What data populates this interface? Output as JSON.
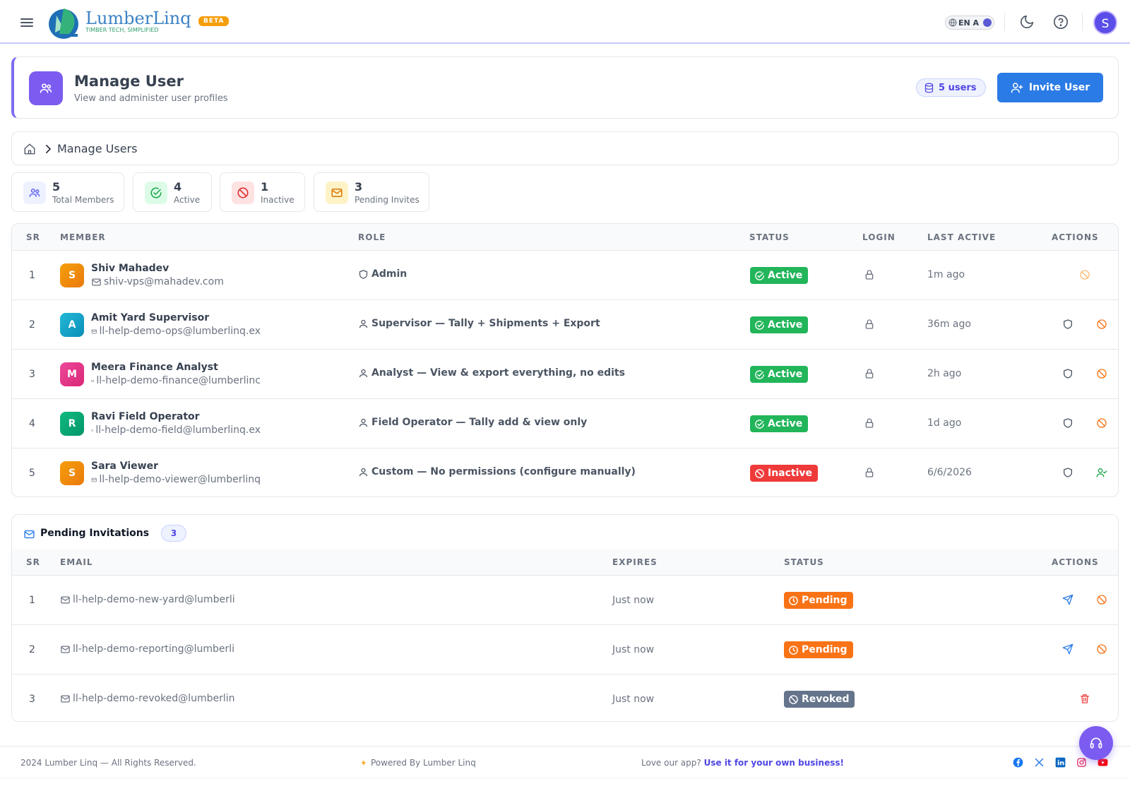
{
  "brand": {
    "name": "LumberLinq",
    "tagline": "TIMBER TECH, SIMPLIFIED",
    "beta": "BETA"
  },
  "topbar": {
    "lang": "EN A",
    "avatar_initial": "S"
  },
  "header": {
    "title": "Manage User",
    "subtitle": "View and administer user profiles",
    "user_count": "5 users",
    "invite_label": "Invite User"
  },
  "breadcrumb": {
    "current": "Manage Users"
  },
  "stats": [
    {
      "value": "5",
      "label": "Total Members"
    },
    {
      "value": "4",
      "label": "Active"
    },
    {
      "value": "1",
      "label": "Inactive"
    },
    {
      "value": "3",
      "label": "Pending Invites"
    }
  ],
  "members_table": {
    "headers": {
      "sr": "SR",
      "member": "MEMBER",
      "role": "ROLE",
      "status": "STATUS",
      "login": "LOGIN",
      "last_active": "LAST ACTIVE",
      "actions": "ACTIONS"
    },
    "rows": [
      {
        "sr": "1",
        "initial": "S",
        "name": "Shiv Mahadev",
        "email": "shiv-vps@mahadev.com",
        "role": "Admin",
        "status": "Active",
        "last_active": "1m ago"
      },
      {
        "sr": "2",
        "initial": "A",
        "name": "Amit Yard Supervisor",
        "email": "ll-help-demo-ops@lumberlinq.ex",
        "role": "Supervisor — Tally + Shipments + Export",
        "status": "Active",
        "last_active": "36m ago"
      },
      {
        "sr": "3",
        "initial": "M",
        "name": "Meera Finance Analyst",
        "email": "ll-help-demo-finance@lumberlinc",
        "role": "Analyst — View & export everything, no edits",
        "status": "Active",
        "last_active": "2h ago"
      },
      {
        "sr": "4",
        "initial": "R",
        "name": "Ravi Field Operator",
        "email": "ll-help-demo-field@lumberlinq.ex",
        "role": "Field Operator — Tally add & view only",
        "status": "Active",
        "last_active": "1d ago"
      },
      {
        "sr": "5",
        "initial": "S",
        "name": "Sara Viewer",
        "email": "ll-help-demo-viewer@lumberlinq",
        "role": "Custom — No permissions (configure manually)",
        "status": "Inactive",
        "last_active": "6/6/2026"
      }
    ]
  },
  "invitations": {
    "title": "Pending Invitations",
    "count": "3",
    "headers": {
      "sr": "SR",
      "email": "EMAIL",
      "expires": "EXPIRES",
      "status": "STATUS",
      "actions": "ACTIONS"
    },
    "rows": [
      {
        "sr": "1",
        "email": "ll-help-demo-new-yard@lumberli",
        "expires": "Just now",
        "status": "Pending"
      },
      {
        "sr": "2",
        "email": "ll-help-demo-reporting@lumberli",
        "expires": "Just now",
        "status": "Pending"
      },
      {
        "sr": "3",
        "email": "ll-help-demo-revoked@lumberlin",
        "expires": "Just now",
        "status": "Revoked"
      }
    ]
  },
  "footer": {
    "copyright": "2024 Lumber Linq — All Rights Reserved.",
    "powered": "Powered By Lumber Linq",
    "love_prefix": "Love our app?",
    "love_link": "Use it for your own business!"
  },
  "colors": {
    "accent": "#7c5cf0",
    "primary": "#2b7be6",
    "active": "#22b55a",
    "inactive": "#ef3a3a",
    "pending": "#f97316",
    "revoked": "#64748b"
  }
}
